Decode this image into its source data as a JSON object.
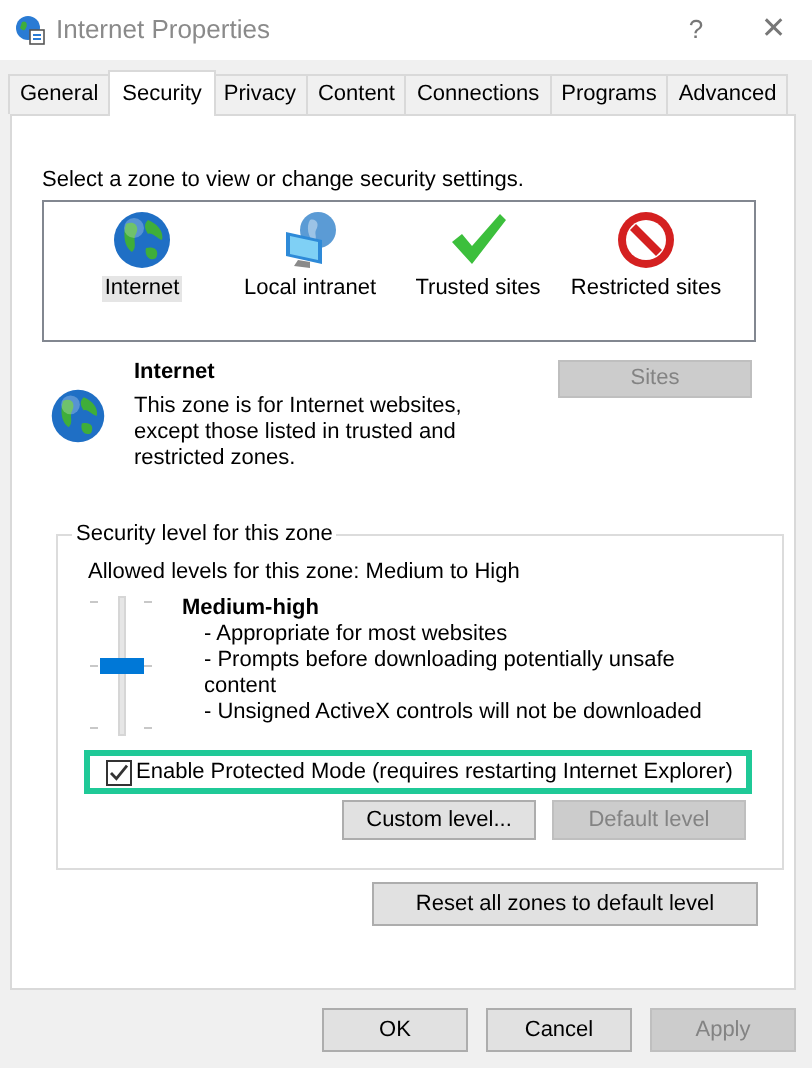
{
  "window": {
    "title": "Internet Properties",
    "help": "?",
    "close": "✕"
  },
  "tabs": [
    {
      "label": "General",
      "selected": false
    },
    {
      "label": "Security",
      "selected": true
    },
    {
      "label": "Privacy",
      "selected": false
    },
    {
      "label": "Content",
      "selected": false
    },
    {
      "label": "Connections",
      "selected": false
    },
    {
      "label": "Programs",
      "selected": false
    },
    {
      "label": "Advanced",
      "selected": false
    }
  ],
  "zone_prompt": "Select a zone to view or change security settings.",
  "zones": [
    {
      "label": "Internet",
      "kind": "globe",
      "selected": true
    },
    {
      "label": "Local intranet",
      "kind": "intranet",
      "selected": false
    },
    {
      "label": "Trusted sites",
      "kind": "check",
      "selected": false
    },
    {
      "label": "Restricted sites",
      "kind": "blocked",
      "selected": false
    }
  ],
  "zone_info": {
    "name": "Internet",
    "description": "This zone is for Internet websites, except those listed in trusted and restricted zones.",
    "sites_button": {
      "label": "Sites",
      "disabled": true
    }
  },
  "security_level": {
    "legend": "Security level for this zone",
    "allowed": "Allowed levels for this zone: Medium to High",
    "level": 0.5,
    "level_name": "Medium-high",
    "bullets": [
      "- Appropriate for most websites",
      "- Prompts before downloading potentially unsafe content",
      "- Unsigned ActiveX controls will not be downloaded"
    ],
    "protected_mode": {
      "label": "Enable Protected Mode (requires restarting Internet Explorer)",
      "checked": true,
      "highlighted": true
    },
    "buttons": [
      {
        "label": "Custom level...",
        "disabled": false
      },
      {
        "label": "Default level",
        "disabled": true
      }
    ]
  },
  "reset_button": {
    "label": "Reset all zones to default level",
    "disabled": false
  },
  "dialog_buttons": [
    {
      "label": "OK",
      "disabled": false
    },
    {
      "label": "Cancel",
      "disabled": false
    },
    {
      "label": "Apply",
      "disabled": true
    }
  ]
}
